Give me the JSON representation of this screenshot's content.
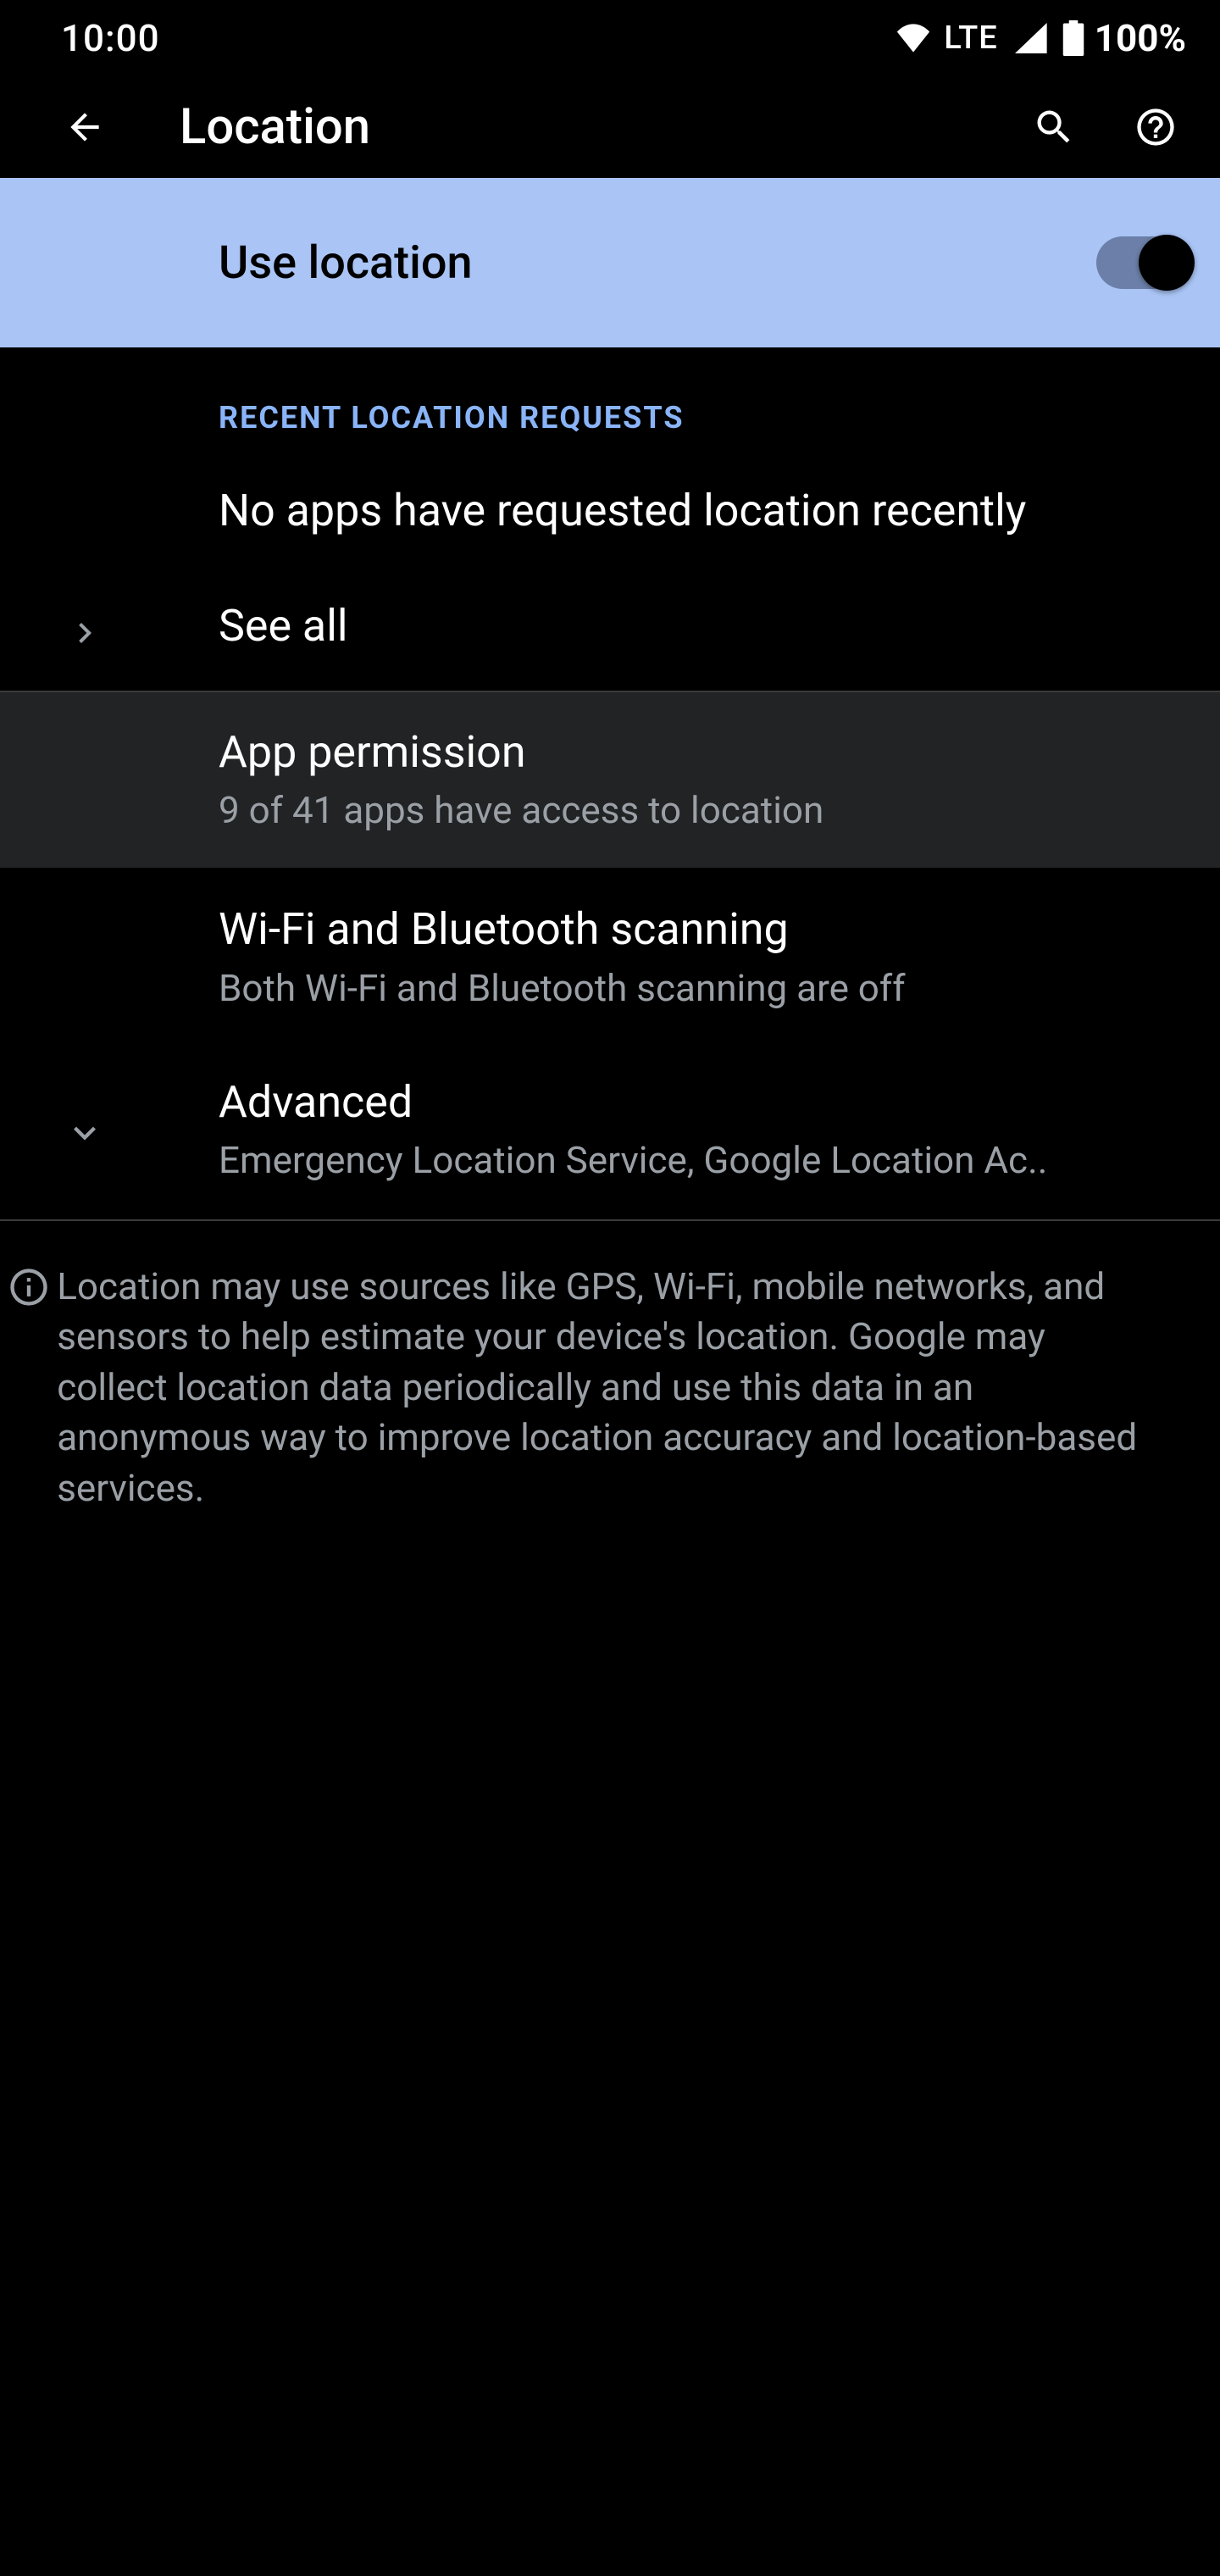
{
  "status": {
    "time": "10:00",
    "network_label": "LTE",
    "battery": "100%"
  },
  "appbar": {
    "title": "Location"
  },
  "toggle": {
    "label": "Use location",
    "on": true
  },
  "section_recent": {
    "heading": "RECENT LOCATION REQUESTS",
    "empty_text": "No apps have requested location recently",
    "see_all": "See all"
  },
  "rows": {
    "app_permission": {
      "title": "App permission",
      "subtitle": "9 of 41 apps have access to location"
    },
    "scanning": {
      "title": "Wi-Fi and Bluetooth scanning",
      "subtitle": "Both Wi-Fi and Bluetooth scanning are off"
    },
    "advanced": {
      "title": "Advanced",
      "subtitle": "Emergency Location Service, Google Location Ac.."
    }
  },
  "info": "Location may use sources like GPS, Wi-Fi, mobile networks, and sensors to help estimate your device's location. Google may collect location data periodically and use this data in an anonymous way to improve location accuracy and location-based services."
}
